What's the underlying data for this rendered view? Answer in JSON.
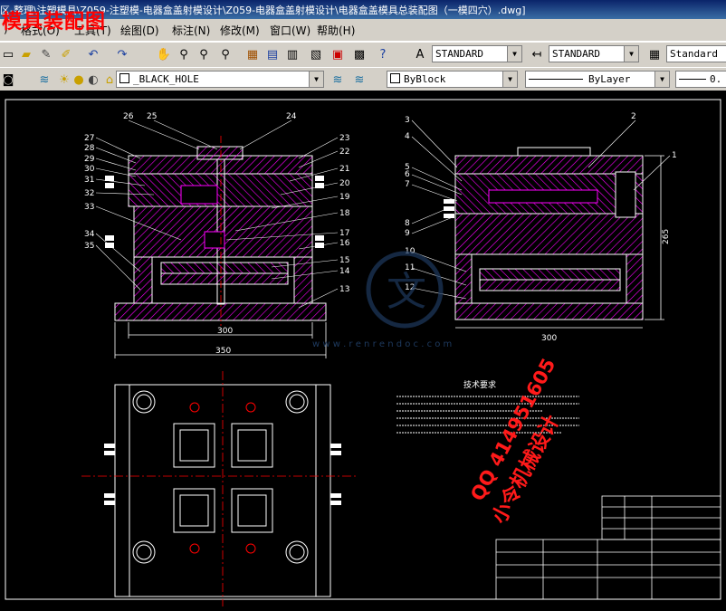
{
  "window": {
    "path": "区-整理\\注塑模具\\Z059-注塑模-电器盒盖射模设计\\Z059-电器盒盖射模设计\\电器盒盖模具总装配图（一模四穴）.dwg]",
    "overlay_title": "模具装配图"
  },
  "menu": {
    "items": [
      "格式(O)",
      "工具(T)",
      "绘图(D)",
      "标注(N)",
      "修改(M)",
      "窗口(W)",
      "帮助(H)"
    ]
  },
  "toolbar1": {
    "text_style": "STANDARD",
    "dim_style": "STANDARD",
    "table_style": "Standard"
  },
  "toolbar2": {
    "layer": "_BLACK_HOLE",
    "color": "ByBlock",
    "linetype": "ByLayer",
    "lineweight": "0."
  },
  "drawing": {
    "left_view_callouts_left": [
      "27",
      "28",
      "29",
      "30",
      "31",
      "32",
      "33",
      "34",
      "35"
    ],
    "left_view_callouts_top": [
      "26",
      "25",
      "24"
    ],
    "left_view_callouts_right": [
      "23",
      "22",
      "21",
      "20",
      "19",
      "18",
      "17",
      "16",
      "15",
      "14",
      "13"
    ],
    "right_view_callouts_left": [
      "3",
      "4",
      "5",
      "6",
      "7",
      "8",
      "9",
      "10",
      "11",
      "12"
    ],
    "right_view_callouts_top": [
      "2",
      "1"
    ],
    "dim_left_300": "300",
    "dim_left_350": "350",
    "dim_right_300": "300",
    "dim_right_265": "265",
    "tech_title": "技术要求",
    "watermark_site": "w w w . r e n r e n d o c . c o m",
    "watermark_logo": "文",
    "watermark_qq": "QQ 414951605",
    "watermark_name": "小令机械设计"
  },
  "colors": {
    "canvas": "#000000",
    "part": "#ff00ff",
    "outline": "#ffffff",
    "center": "#ff0000",
    "dim": "#ffffff",
    "watermark": "#ff1a1a"
  }
}
